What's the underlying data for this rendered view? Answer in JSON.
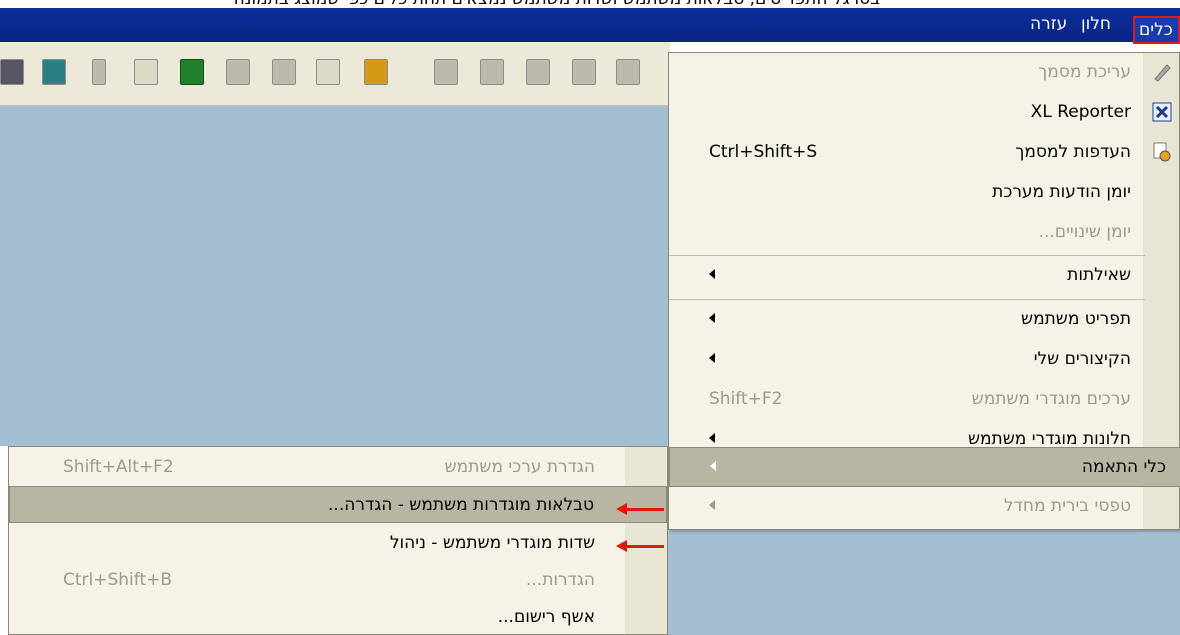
{
  "caption": "בסרגל התפריטים, טבלאות משתמש ושדות משתמש נמצאים תחת כלים כפי שמוצג בתמונה",
  "menubar": {
    "items": [
      {
        "label": "כלים"
      },
      {
        "label": "חלון"
      },
      {
        "label": "עזרה"
      }
    ]
  },
  "toolbar": {
    "icons": [
      "print-icon",
      "transfer-icon",
      "phone-icon",
      "fax-icon",
      "excel-icon",
      "word-icon",
      "wizard-icon",
      "navigate-icon",
      "lock-icon",
      "binoculars-icon",
      "grid-icon",
      "first-record-icon",
      "prev-record-icon",
      "next-record-icon"
    ]
  },
  "tools_menu": {
    "items": [
      {
        "label": "עריכת מסמך",
        "disabled": true
      },
      {
        "label": "XL Reporter"
      },
      {
        "label": "העדפות למסמך",
        "shortcut": "Ctrl+Shift+S"
      },
      {
        "label": "יומן הודעות מערכת"
      },
      {
        "label": "יומן שינויים...",
        "disabled": true
      },
      {
        "label": "שאילתות"
      },
      {
        "label": "תפריט משתמש"
      },
      {
        "label": "הקיצורים שלי"
      },
      {
        "label": "ערכים מוגדרי משתמש",
        "shortcut": "Shift+F2",
        "disabled": true
      },
      {
        "label": "חלונות מוגדרי משתמש"
      },
      {
        "label": "כלי התאמה"
      },
      {
        "label": "טפסי בירית מחדל",
        "disabled": true
      }
    ]
  },
  "customization_submenu": {
    "items": [
      {
        "label": "הגדרת ערכי משתמש",
        "shortcut": "Shift+Alt+F2",
        "disabled": true
      },
      {
        "label": "טבלאות מוגדרות משתמש - הגדרה..."
      },
      {
        "label": "שדות מוגדרי משתמש - ניהול"
      },
      {
        "label": "הגדרות...",
        "shortcut": "Ctrl+Shift+B",
        "disabled": true
      },
      {
        "label": "אשף רישום..."
      }
    ]
  },
  "colors": {
    "menubar": "#0c2d9a",
    "highlight_box": "#e01a1a",
    "annotation_arrow": "#e0190f",
    "workarea": "#a3bed3",
    "menu_bg": "#f5f2e7"
  }
}
